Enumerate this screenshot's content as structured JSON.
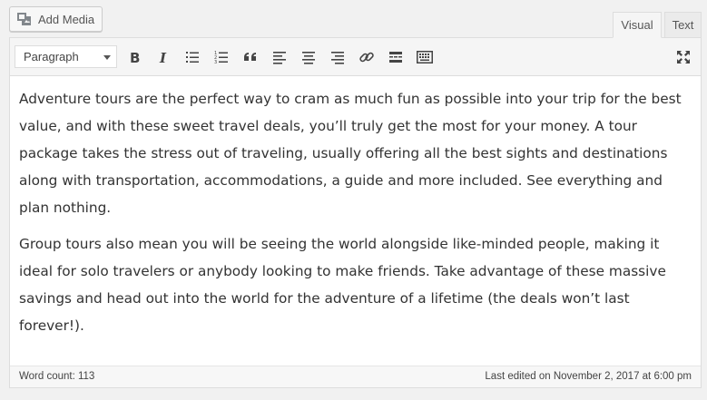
{
  "media": {
    "add_label": "Add Media",
    "icon": "media-icon"
  },
  "tabs": [
    {
      "label": "Visual"
    },
    {
      "label": "Text"
    }
  ],
  "toolbar": {
    "format_select": {
      "value": "Paragraph"
    },
    "buttons": [
      {
        "icon": "bold-icon"
      },
      {
        "icon": "italic-icon"
      },
      {
        "icon": "bulleted-list-icon"
      },
      {
        "icon": "numbered-list-icon"
      },
      {
        "icon": "blockquote-icon"
      },
      {
        "icon": "align-left-icon"
      },
      {
        "icon": "align-center-icon"
      },
      {
        "icon": "align-right-icon"
      },
      {
        "icon": "link-icon"
      },
      {
        "icon": "read-more-icon"
      },
      {
        "icon": "toolbar-toggle-icon"
      },
      {
        "icon": "fullscreen-icon"
      }
    ]
  },
  "content": {
    "paragraphs": [
      "Adventure tours are the perfect way to cram as much fun as possible into your trip for the best value, and with these sweet travel deals, you’ll truly get the most for your money. A tour package takes the stress out of traveling, usually offering all the best sights and destinations along with transportation, accommodations, a guide and more included. See everything and plan nothing.",
      "Group tours also mean you will be seeing the world alongside like-minded people, making it ideal for solo travelers or anybody looking to make friends. Take advantage of these massive savings and head out into the world for the adventure of a lifetime (the deals won’t last forever!)."
    ]
  },
  "status": {
    "word_count": "Word count: 113",
    "last_edited": "Last edited on November 2, 2017 at 6:00 pm"
  }
}
